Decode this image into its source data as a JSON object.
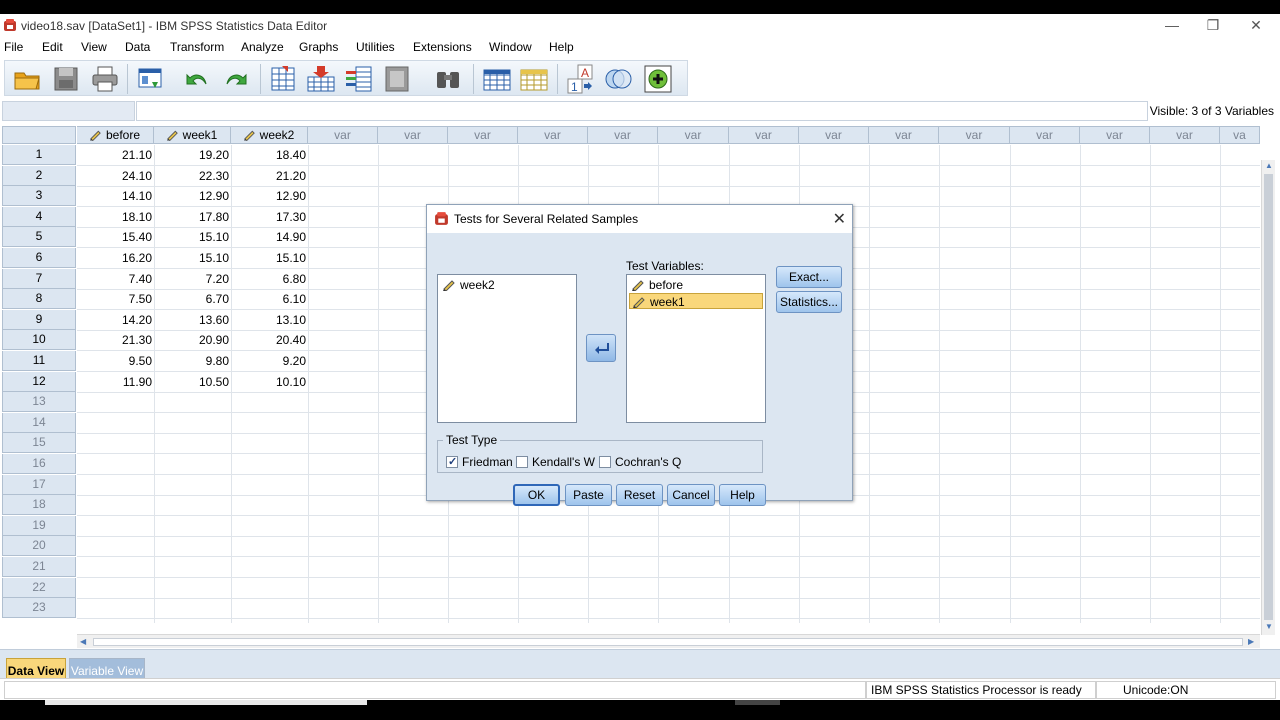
{
  "window": {
    "title": "video18.sav [DataSet1] - IBM SPSS Statistics Data Editor",
    "controls": {
      "minimize": "—",
      "restore": "❐",
      "close": "✕"
    }
  },
  "menu": [
    "File",
    "Edit",
    "View",
    "Data",
    "Transform",
    "Analyze",
    "Graphs",
    "Utilities",
    "Extensions",
    "Window",
    "Help"
  ],
  "toolbar": {
    "icons": [
      "open-icon",
      "save-icon",
      "print-icon",
      "dialog-recall-icon",
      "undo-icon",
      "redo-icon",
      "goto-case-icon",
      "goto-variable-icon",
      "variables-icon",
      "run-descriptives-icon",
      "find-icon",
      "insert-cases-icon",
      "insert-variable-icon",
      "split-file-icon",
      "select-cases-icon",
      "value-labels-icon",
      "use-variable-sets-icon"
    ],
    "value_labels_glyph": {
      "a": "A",
      "one": "1"
    }
  },
  "editline": {
    "visible": "Visible: 3 of 3 Variables"
  },
  "grid": {
    "columns": [
      "before",
      "week1",
      "week2"
    ],
    "empty_column_label": "var",
    "empty_column_label_cut": "va",
    "rows": [
      [
        "21.10",
        "19.20",
        "18.40"
      ],
      [
        "24.10",
        "22.30",
        "21.20"
      ],
      [
        "14.10",
        "12.90",
        "12.90"
      ],
      [
        "18.10",
        "17.80",
        "17.30"
      ],
      [
        "15.40",
        "15.10",
        "14.90"
      ],
      [
        "16.20",
        "15.10",
        "15.10"
      ],
      [
        "7.40",
        "7.20",
        "6.80"
      ],
      [
        "7.50",
        "6.70",
        "6.10"
      ],
      [
        "14.20",
        "13.60",
        "13.10"
      ],
      [
        "21.30",
        "20.90",
        "20.40"
      ],
      [
        "9.50",
        "9.80",
        "9.20"
      ],
      [
        "11.90",
        "10.50",
        "10.10"
      ]
    ],
    "row_numbers": [
      "1",
      "2",
      "3",
      "4",
      "5",
      "6",
      "7",
      "8",
      "9",
      "10",
      "11",
      "12",
      "13",
      "14",
      "15",
      "16",
      "17",
      "18",
      "19",
      "20",
      "21",
      "22",
      "23"
    ]
  },
  "tabs": {
    "data_view": "Data View",
    "variable_view": "Variable View"
  },
  "status": {
    "processor": "IBM SPSS Statistics Processor is ready",
    "unicode": "Unicode:ON"
  },
  "dialog": {
    "title": "Tests for Several Related Samples",
    "close": "✕",
    "source_variables": [
      "week2"
    ],
    "test_variables_label": "Test Variables:",
    "test_variables": [
      "before",
      "week1"
    ],
    "selected_test_variable": "week1",
    "exact_button": "Exact...",
    "statistics_button": "Statistics...",
    "test_type_label": "Test Type",
    "test_types": [
      {
        "label": "Friedman",
        "checked": true
      },
      {
        "label": "Kendall's W",
        "checked": false
      },
      {
        "label": "Cochran's Q",
        "checked": false
      }
    ],
    "buttons": {
      "ok": "OK",
      "paste": "Paste",
      "reset": "Reset",
      "cancel": "Cancel",
      "help": "Help"
    }
  },
  "colors": {
    "accent_selected": "#f9d77b",
    "header_bg": "#dce6f1",
    "button_blue": "#9ec4ec"
  }
}
